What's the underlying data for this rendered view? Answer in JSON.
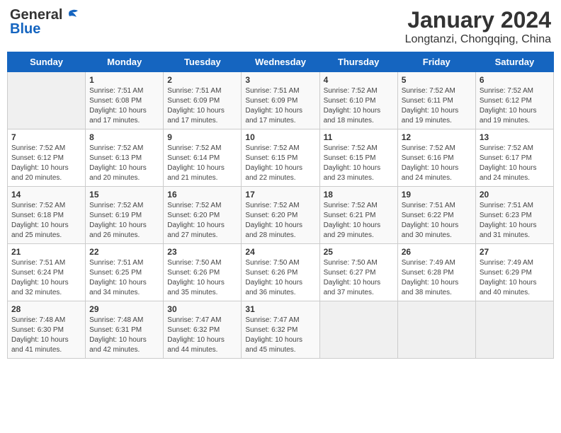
{
  "logo": {
    "general": "General",
    "blue": "Blue"
  },
  "title": {
    "month_year": "January 2024",
    "location": "Longtanzi, Chongqing, China"
  },
  "days_of_week": [
    "Sunday",
    "Monday",
    "Tuesday",
    "Wednesday",
    "Thursday",
    "Friday",
    "Saturday"
  ],
  "weeks": [
    {
      "cells": [
        {
          "day": "",
          "empty": true
        },
        {
          "day": "",
          "empty": true
        },
        {
          "day": "",
          "empty": true
        },
        {
          "day": "",
          "empty": true
        },
        {
          "day": "",
          "empty": true
        },
        {
          "day": "",
          "empty": true
        },
        {
          "day": "",
          "empty": true
        }
      ]
    }
  ],
  "calendar": [
    [
      {
        "num": "",
        "sunrise": "",
        "sunset": "",
        "daylight": "",
        "empty": true
      },
      {
        "num": "1",
        "sunrise": "Sunrise: 7:51 AM",
        "sunset": "Sunset: 6:08 PM",
        "daylight": "Daylight: 10 hours and 17 minutes."
      },
      {
        "num": "2",
        "sunrise": "Sunrise: 7:51 AM",
        "sunset": "Sunset: 6:09 PM",
        "daylight": "Daylight: 10 hours and 17 minutes."
      },
      {
        "num": "3",
        "sunrise": "Sunrise: 7:51 AM",
        "sunset": "Sunset: 6:09 PM",
        "daylight": "Daylight: 10 hours and 17 minutes."
      },
      {
        "num": "4",
        "sunrise": "Sunrise: 7:52 AM",
        "sunset": "Sunset: 6:10 PM",
        "daylight": "Daylight: 10 hours and 18 minutes."
      },
      {
        "num": "5",
        "sunrise": "Sunrise: 7:52 AM",
        "sunset": "Sunset: 6:11 PM",
        "daylight": "Daylight: 10 hours and 19 minutes."
      },
      {
        "num": "6",
        "sunrise": "Sunrise: 7:52 AM",
        "sunset": "Sunset: 6:12 PM",
        "daylight": "Daylight: 10 hours and 19 minutes."
      }
    ],
    [
      {
        "num": "7",
        "sunrise": "Sunrise: 7:52 AM",
        "sunset": "Sunset: 6:12 PM",
        "daylight": "Daylight: 10 hours and 20 minutes."
      },
      {
        "num": "8",
        "sunrise": "Sunrise: 7:52 AM",
        "sunset": "Sunset: 6:13 PM",
        "daylight": "Daylight: 10 hours and 20 minutes."
      },
      {
        "num": "9",
        "sunrise": "Sunrise: 7:52 AM",
        "sunset": "Sunset: 6:14 PM",
        "daylight": "Daylight: 10 hours and 21 minutes."
      },
      {
        "num": "10",
        "sunrise": "Sunrise: 7:52 AM",
        "sunset": "Sunset: 6:15 PM",
        "daylight": "Daylight: 10 hours and 22 minutes."
      },
      {
        "num": "11",
        "sunrise": "Sunrise: 7:52 AM",
        "sunset": "Sunset: 6:15 PM",
        "daylight": "Daylight: 10 hours and 23 minutes."
      },
      {
        "num": "12",
        "sunrise": "Sunrise: 7:52 AM",
        "sunset": "Sunset: 6:16 PM",
        "daylight": "Daylight: 10 hours and 24 minutes."
      },
      {
        "num": "13",
        "sunrise": "Sunrise: 7:52 AM",
        "sunset": "Sunset: 6:17 PM",
        "daylight": "Daylight: 10 hours and 24 minutes."
      }
    ],
    [
      {
        "num": "14",
        "sunrise": "Sunrise: 7:52 AM",
        "sunset": "Sunset: 6:18 PM",
        "daylight": "Daylight: 10 hours and 25 minutes."
      },
      {
        "num": "15",
        "sunrise": "Sunrise: 7:52 AM",
        "sunset": "Sunset: 6:19 PM",
        "daylight": "Daylight: 10 hours and 26 minutes."
      },
      {
        "num": "16",
        "sunrise": "Sunrise: 7:52 AM",
        "sunset": "Sunset: 6:20 PM",
        "daylight": "Daylight: 10 hours and 27 minutes."
      },
      {
        "num": "17",
        "sunrise": "Sunrise: 7:52 AM",
        "sunset": "Sunset: 6:20 PM",
        "daylight": "Daylight: 10 hours and 28 minutes."
      },
      {
        "num": "18",
        "sunrise": "Sunrise: 7:52 AM",
        "sunset": "Sunset: 6:21 PM",
        "daylight": "Daylight: 10 hours and 29 minutes."
      },
      {
        "num": "19",
        "sunrise": "Sunrise: 7:51 AM",
        "sunset": "Sunset: 6:22 PM",
        "daylight": "Daylight: 10 hours and 30 minutes."
      },
      {
        "num": "20",
        "sunrise": "Sunrise: 7:51 AM",
        "sunset": "Sunset: 6:23 PM",
        "daylight": "Daylight: 10 hours and 31 minutes."
      }
    ],
    [
      {
        "num": "21",
        "sunrise": "Sunrise: 7:51 AM",
        "sunset": "Sunset: 6:24 PM",
        "daylight": "Daylight: 10 hours and 32 minutes."
      },
      {
        "num": "22",
        "sunrise": "Sunrise: 7:51 AM",
        "sunset": "Sunset: 6:25 PM",
        "daylight": "Daylight: 10 hours and 34 minutes."
      },
      {
        "num": "23",
        "sunrise": "Sunrise: 7:50 AM",
        "sunset": "Sunset: 6:26 PM",
        "daylight": "Daylight: 10 hours and 35 minutes."
      },
      {
        "num": "24",
        "sunrise": "Sunrise: 7:50 AM",
        "sunset": "Sunset: 6:26 PM",
        "daylight": "Daylight: 10 hours and 36 minutes."
      },
      {
        "num": "25",
        "sunrise": "Sunrise: 7:50 AM",
        "sunset": "Sunset: 6:27 PM",
        "daylight": "Daylight: 10 hours and 37 minutes."
      },
      {
        "num": "26",
        "sunrise": "Sunrise: 7:49 AM",
        "sunset": "Sunset: 6:28 PM",
        "daylight": "Daylight: 10 hours and 38 minutes."
      },
      {
        "num": "27",
        "sunrise": "Sunrise: 7:49 AM",
        "sunset": "Sunset: 6:29 PM",
        "daylight": "Daylight: 10 hours and 40 minutes."
      }
    ],
    [
      {
        "num": "28",
        "sunrise": "Sunrise: 7:48 AM",
        "sunset": "Sunset: 6:30 PM",
        "daylight": "Daylight: 10 hours and 41 minutes."
      },
      {
        "num": "29",
        "sunrise": "Sunrise: 7:48 AM",
        "sunset": "Sunset: 6:31 PM",
        "daylight": "Daylight: 10 hours and 42 minutes."
      },
      {
        "num": "30",
        "sunrise": "Sunrise: 7:47 AM",
        "sunset": "Sunset: 6:32 PM",
        "daylight": "Daylight: 10 hours and 44 minutes."
      },
      {
        "num": "31",
        "sunrise": "Sunrise: 7:47 AM",
        "sunset": "Sunset: 6:32 PM",
        "daylight": "Daylight: 10 hours and 45 minutes."
      },
      {
        "num": "",
        "sunrise": "",
        "sunset": "",
        "daylight": "",
        "empty": true
      },
      {
        "num": "",
        "sunrise": "",
        "sunset": "",
        "daylight": "",
        "empty": true
      },
      {
        "num": "",
        "sunrise": "",
        "sunset": "",
        "daylight": "",
        "empty": true
      }
    ]
  ]
}
